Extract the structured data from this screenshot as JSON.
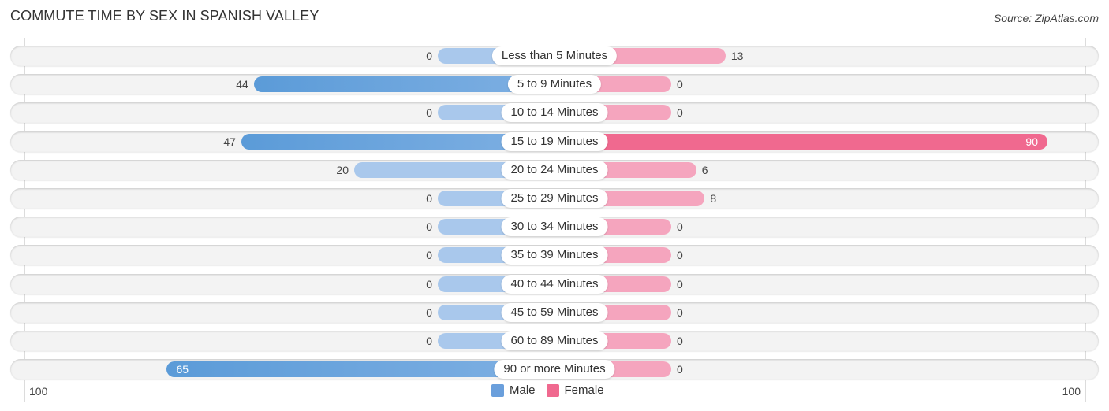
{
  "chart_data": {
    "type": "bar",
    "orientation": "horizontal-diverging",
    "title": "COMMUTE TIME BY SEX IN SPANISH VALLEY",
    "source": "Source: ZipAtlas.com",
    "categories": [
      "Less than 5 Minutes",
      "5 to 9 Minutes",
      "10 to 14 Minutes",
      "15 to 19 Minutes",
      "20 to 24 Minutes",
      "25 to 29 Minutes",
      "30 to 34 Minutes",
      "35 to 39 Minutes",
      "40 to 44 Minutes",
      "45 to 59 Minutes",
      "60 to 89 Minutes",
      "90 or more Minutes"
    ],
    "series": [
      {
        "name": "Male",
        "color": "#6a9fdc",
        "values": [
          0,
          44,
          0,
          47,
          20,
          0,
          0,
          0,
          0,
          0,
          0,
          65
        ]
      },
      {
        "name": "Female",
        "color": "#f0698f",
        "values": [
          13,
          0,
          0,
          90,
          6,
          8,
          0,
          0,
          0,
          0,
          0,
          0
        ]
      }
    ],
    "axis": {
      "left_label": "100",
      "right_label": "100",
      "max": 100
    },
    "legend": {
      "placement": "bottom-center",
      "entries": [
        "Male",
        "Female"
      ]
    },
    "grid": false
  }
}
